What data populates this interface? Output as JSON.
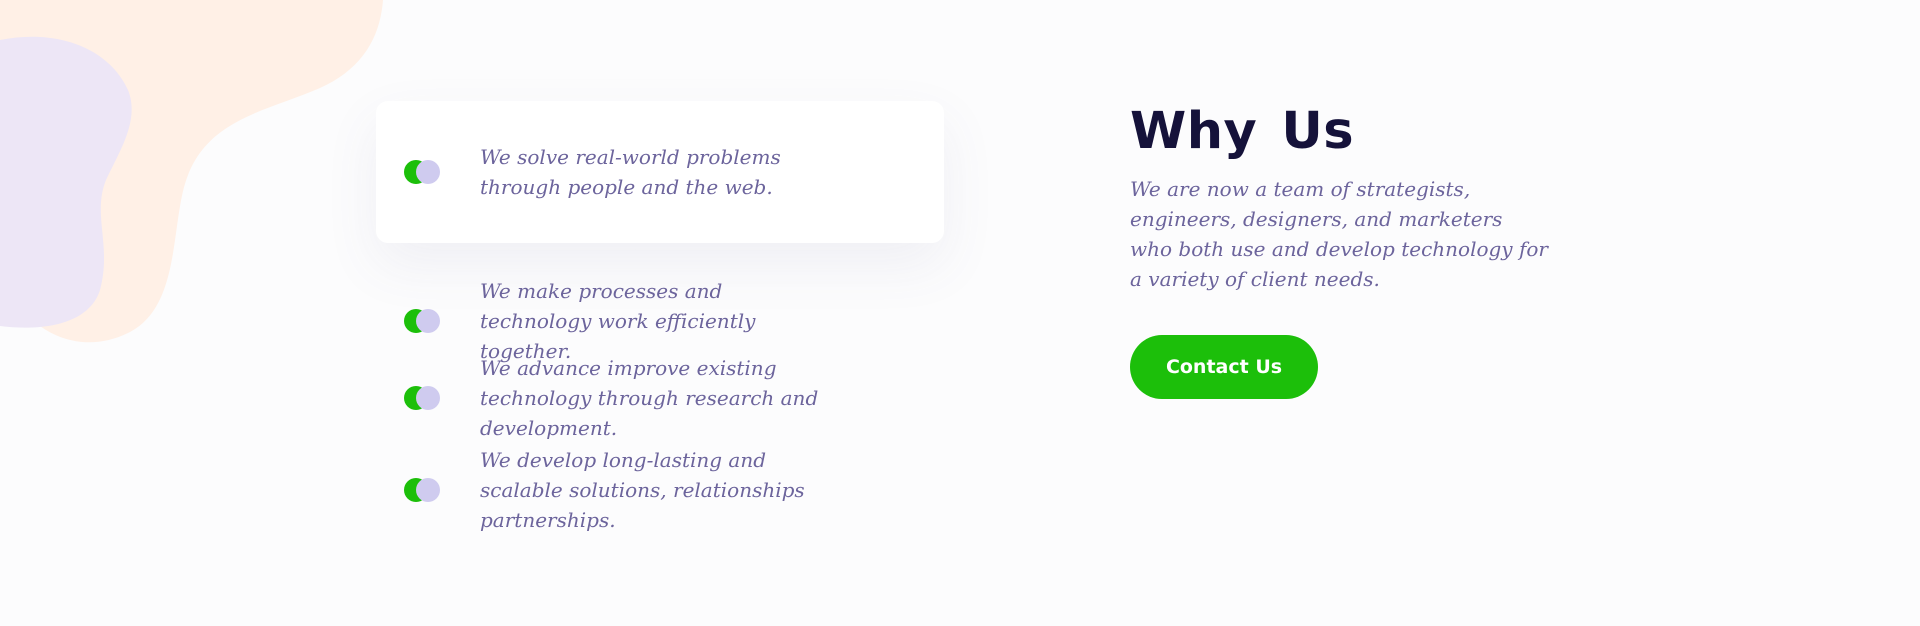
{
  "features": [
    {
      "text": "We solve real-world problems through people and the web."
    },
    {
      "text": "We make processes and technology work efficiently together."
    },
    {
      "text": "We advance improve existing technology through research and development."
    },
    {
      "text": "We develop long-lasting and scalable solutions, relationships partnerships."
    }
  ],
  "why": {
    "word1": "Why",
    "word2": "Us",
    "description": "We are now a team of strategists, engineers, designers, and marketers who both use and develop technology for a variety of client needs.",
    "cta_label": "Contact Us"
  },
  "colors": {
    "accent_green": "#1cbf0a",
    "toggle_lilac": "#cfcbef",
    "heading": "#15123a",
    "body_text": "#6c649c",
    "blob_peach": "#fff0e6",
    "blob_lavender": "#ede6f6",
    "background": "#fcfcfd"
  }
}
